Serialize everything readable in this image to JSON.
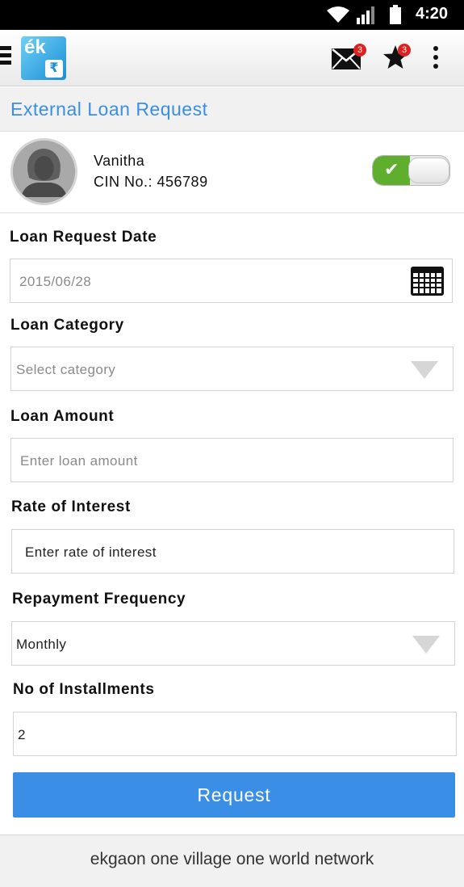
{
  "status_bar": {
    "time": "4:20"
  },
  "app_bar": {
    "logo_text": "ék",
    "logo_symbol": "₹",
    "mail_badge": "3",
    "star_badge": "3"
  },
  "page": {
    "title": "External Loan Request"
  },
  "profile": {
    "name": "Vanitha",
    "cin": "CIN No.: 456789",
    "toggle_on": true
  },
  "form": {
    "loan_request_date": {
      "label": "Loan Request Date",
      "value": "2015/06/28"
    },
    "loan_category": {
      "label": "Loan Category",
      "placeholder": "Select category"
    },
    "loan_amount": {
      "label": "Loan Amount",
      "placeholder": "Enter loan amount"
    },
    "rate_of_interest": {
      "label": "Rate of Interest",
      "placeholder": "Enter rate of interest"
    },
    "repayment_frequency": {
      "label": "Repayment Frequency",
      "value": "Monthly"
    },
    "no_of_installments": {
      "label": "No of Installments",
      "value": "2"
    },
    "submit_label": "Request"
  },
  "footer": {
    "text": "ekgaon one village one world network"
  },
  "colors": {
    "accent": "#3a8ee6",
    "toggle_on": "#5fae2e",
    "badge": "#e02020"
  }
}
